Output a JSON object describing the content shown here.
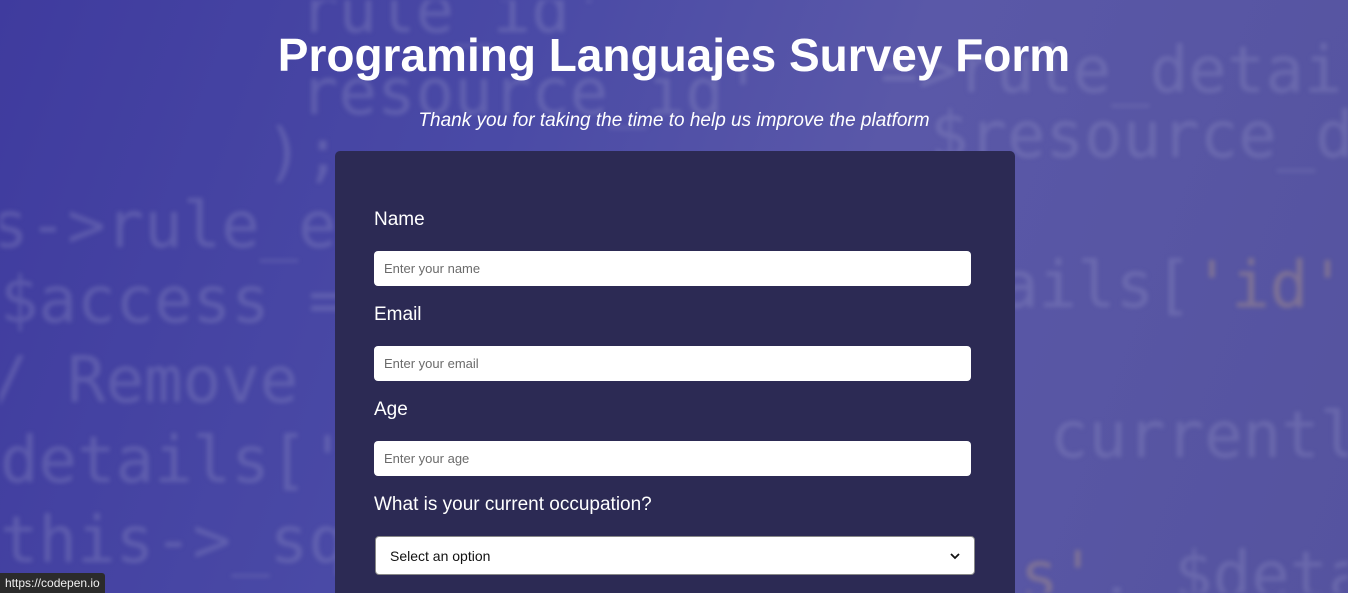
{
  "header": {
    "title": "Programing Languajes Survey Form",
    "description": "Thank you for taking the time to help us improve the platform"
  },
  "form": {
    "name_label": "Name",
    "name_placeholder": "Enter your name",
    "email_label": "Email",
    "email_placeholder": "Enter your email",
    "age_label": "Age",
    "age_placeholder": "Enter your age",
    "occupation_label": "What is your current occupation?",
    "occupation_selected": "Select an option"
  },
  "status_bar": {
    "url": "https://codepen.io"
  },
  "colors": {
    "card_background": "#2c2a54",
    "page_gradient_start": "#3f3b9e",
    "page_gradient_end": "#5a58a8"
  }
}
